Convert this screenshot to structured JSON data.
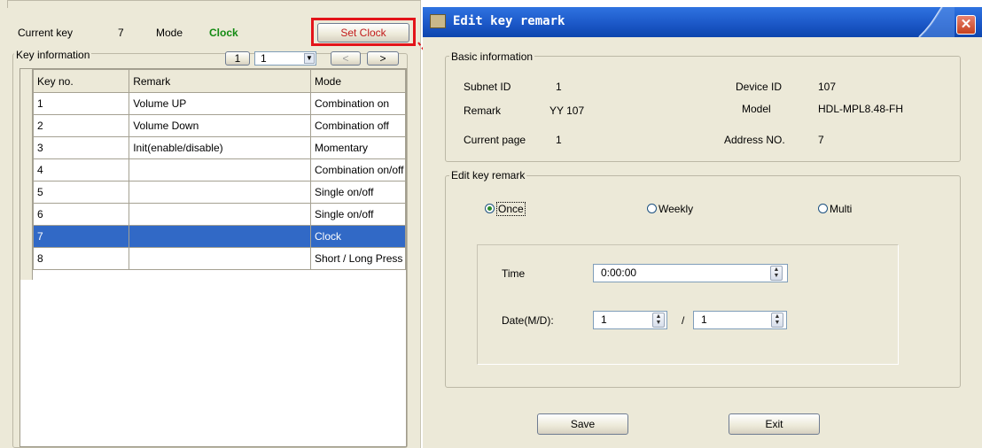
{
  "left": {
    "current_key_label": "Current key",
    "current_key_value": "7",
    "mode_label": "Mode",
    "mode_value": "Clock",
    "set_clock_label": "Set Clock",
    "key_info_title": "Key information",
    "pager": {
      "page_button": "1",
      "page_value": "1",
      "prev": "<",
      "next": ">"
    },
    "table": {
      "columns": [
        "Key no.",
        "Remark",
        "Mode"
      ],
      "rows": [
        [
          "1",
          "Volume UP",
          "Combination on"
        ],
        [
          "2",
          "Volume Down",
          "Combination off"
        ],
        [
          "3",
          "Init(enable/disable)",
          "Momentary"
        ],
        [
          "4",
          "",
          "Combination on/off"
        ],
        [
          "5",
          "",
          "Single on/off"
        ],
        [
          "6",
          "",
          "Single on/off"
        ],
        [
          "7",
          "",
          "Clock"
        ],
        [
          "8",
          "",
          "Short / Long Press"
        ]
      ],
      "selected_row": 7
    }
  },
  "dialog": {
    "title": "Edit key remark",
    "basic": {
      "title": "Basic information",
      "subnet_label": "Subnet ID",
      "subnet_value": "1",
      "device_label": "Device ID",
      "device_value": "107",
      "remark_label": "Remark",
      "remark_value": "YY 107",
      "model_label": "Model",
      "model_value": "HDL-MPL8.48-FH",
      "page_label": "Current page",
      "page_value": "1",
      "address_label": "Address NO.",
      "address_value": "7"
    },
    "edit": {
      "title": "Edit key remark",
      "options": [
        "Once",
        "Weekly",
        "Multi"
      ],
      "selected_option": "Once",
      "time_label": "Time",
      "time_value": "0:00:00",
      "date_label": "Date(M/D):",
      "month_value": "1",
      "separator": "/",
      "day_value": "1"
    },
    "save_label": "Save",
    "exit_label": "Exit"
  },
  "colors": {
    "title_bar": "#1c58c8",
    "selection": "#3169c6",
    "highlight": "#e3141a",
    "mode_value": "#138a13"
  }
}
